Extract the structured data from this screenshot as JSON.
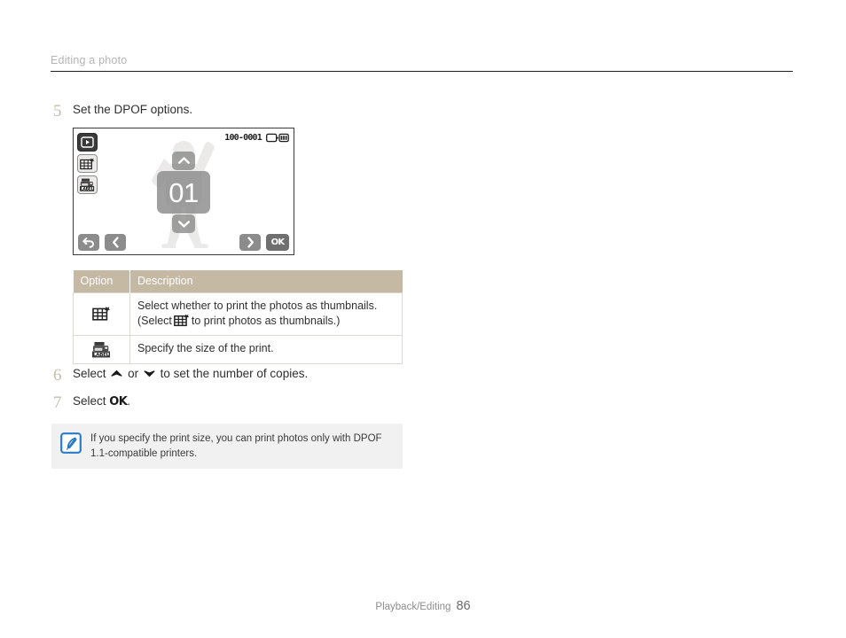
{
  "header": {
    "section_title": "Editing a photo"
  },
  "steps": [
    {
      "number": "5",
      "text": "Set the DPOF options."
    },
    {
      "number": "6",
      "text_before": "Select",
      "icon_up": "chevron-up-icon",
      "text_middle": "or",
      "icon_down": "chevron-down-icon",
      "text_after": "to set the number of copies."
    },
    {
      "number": "7",
      "text_before": "Select",
      "ok_label": "OK",
      "text_after": "."
    }
  ],
  "lcd": {
    "left_icons": [
      {
        "name": "playback-mode-icon",
        "state": "selected"
      },
      {
        "name": "thumbnail-index-print-icon",
        "state": "normal"
      },
      {
        "name": "print-size-label-icon",
        "state": "normal"
      }
    ],
    "status": {
      "file_number": "100-0001",
      "battery_icon": "battery-full-icon"
    },
    "counter": {
      "up_arrow": "chevron-up-icon",
      "value": "01",
      "down_arrow": "chevron-down-icon"
    },
    "nav_buttons": [
      {
        "name": "back-button",
        "icon": "back-arrow-icon"
      },
      {
        "name": "previous-button",
        "icon": "chevron-left-icon"
      },
      {
        "name": "next-button",
        "icon": "chevron-right-icon"
      },
      {
        "name": "ok-button",
        "label": "OK"
      }
    ],
    "photo_subject": "person-silhouette"
  },
  "option_table": {
    "headers": [
      "Option",
      "Description"
    ],
    "rows": [
      {
        "icon": "thumbnail-index-print-icon",
        "description_line1": "Select whether to print the photos as thumbnails.",
        "description_line2_before": "(Select",
        "description_inline_icon": "thumbnail-index-print-icon",
        "description_line2_after": "to print photos as thumbnails.)"
      },
      {
        "icon": "print-size-label-icon",
        "description_line1": "Specify the size of the print.",
        "description_line2_before": "",
        "description_line2_after": ""
      }
    ]
  },
  "note": {
    "icon": "note-pen-icon",
    "text": "If you specify the print size, you can print photos only with DPOF 1.1-compatible printers."
  },
  "footer": {
    "label": "Playback/Editing",
    "page_number": "86"
  },
  "colors": {
    "table_header_bg": "#c6b9a4",
    "step_number": "#c9bda8",
    "note_bg": "#f1f1f1",
    "note_icon": "#2b7cc4",
    "header_text": "#b4b4b4"
  }
}
